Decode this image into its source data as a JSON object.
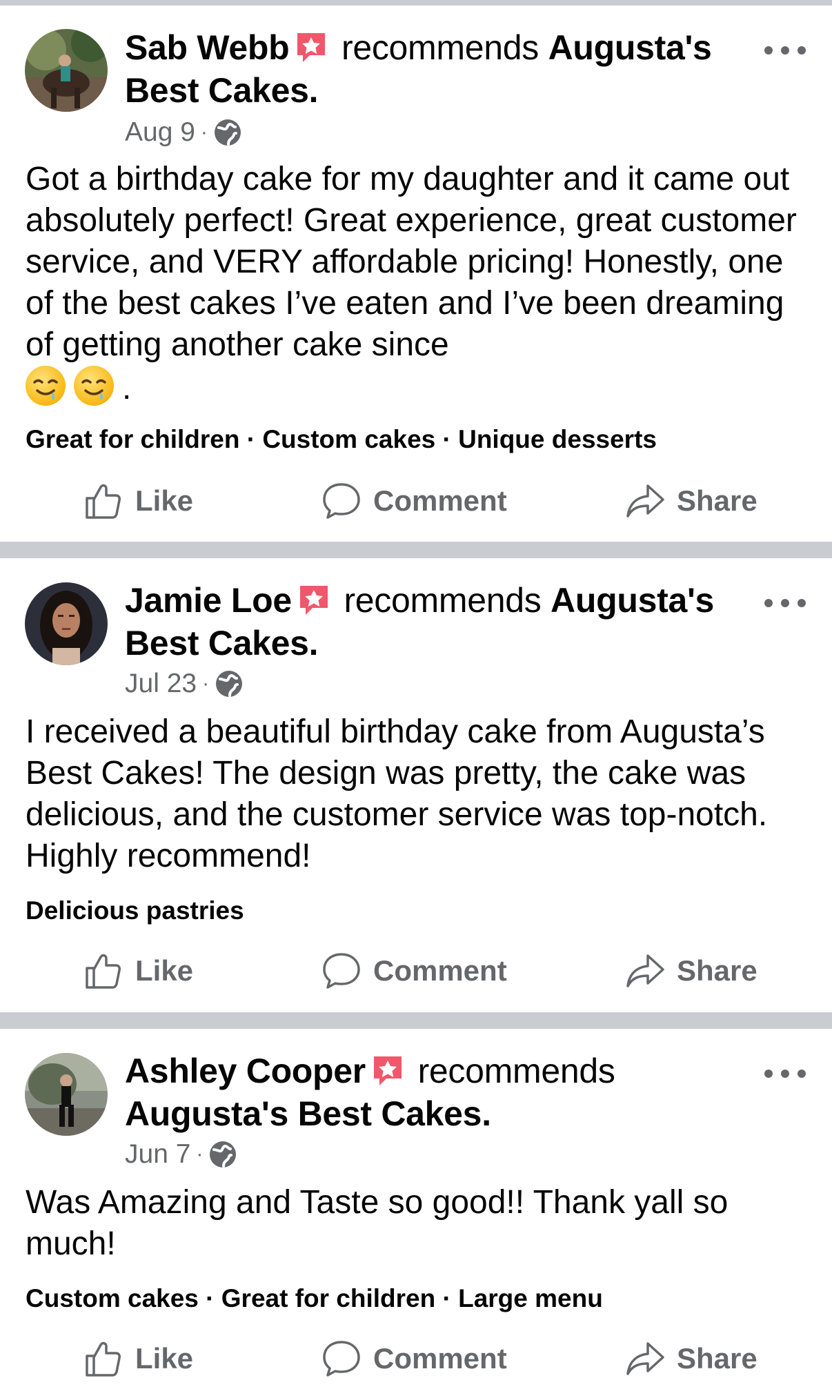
{
  "posts": [
    {
      "author": "Sab Webb",
      "recommends": "recommends",
      "page": "Augusta's Best Cakes.",
      "page_part1": "Augusta's",
      "page_part2": "Best Cakes.",
      "date": "Aug 9",
      "text": "Got a birthday cake for my daughter and it came out absolutely perfect! Great experience, great customer service, and VERY affordable pricing! Honestly, one of the best cakes I’ve eaten and I’ve been dreaming of getting another cake since",
      "text_end": ".",
      "tags": "Great for children · Custom cakes · Unique desserts"
    },
    {
      "author": "Jamie Loe",
      "recommends": "recommends",
      "page_part1": "Augusta's",
      "page_part2": "Best Cakes.",
      "date": "Jul 23",
      "text": "I received a beautiful birthday cake from Augusta’s Best Cakes! The design was pretty, the cake was delicious, and the customer service was top-notch. Highly recommend!",
      "tags": "Delicious pastries"
    },
    {
      "author": "Ashley Cooper",
      "recommends": "recommends",
      "page_part2": "Augusta's Best Cakes.",
      "date": "Jun 7",
      "text": "Was Amazing and Taste so good!! Thank yall so much!",
      "tags": "Custom cakes · Great for children · Large menu"
    }
  ],
  "actions": {
    "like": "Like",
    "comment": "Comment",
    "share": "Share"
  },
  "colors": {
    "separator": "#c9ccd1",
    "secondary_text": "#65676b",
    "badge": "#f0576b"
  },
  "icons": [
    "more-options-icon",
    "globe-icon",
    "like-icon",
    "comment-icon",
    "share-icon",
    "recommendation-badge-icon",
    "drooling-face-emoji"
  ]
}
